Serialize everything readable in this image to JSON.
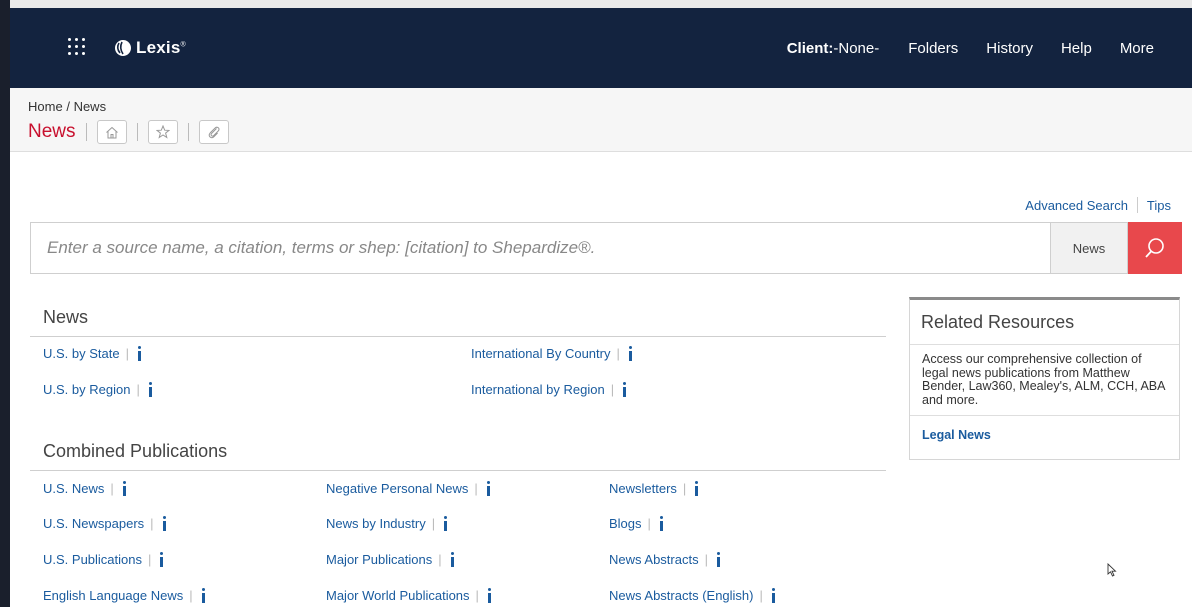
{
  "header": {
    "logo_text": "Lexis",
    "client_label": "Client:",
    "client_value": "-None-",
    "nav": [
      "Folders",
      "History",
      "Help",
      "More"
    ]
  },
  "breadcrumb": {
    "home": "Home",
    "separator": "/",
    "current": "News"
  },
  "page_title": "News",
  "search": {
    "advanced_label": "Advanced Search",
    "tips_label": "Tips",
    "placeholder": "Enter a source name, a citation, terms or shep: [citation] to Shepardize®.",
    "scope_label": "News"
  },
  "news_section": {
    "title": "News",
    "links": [
      "U.S. by State",
      "International By Country",
      "U.S. by Region",
      "International by Region"
    ]
  },
  "combined_section": {
    "title": "Combined Publications",
    "columns": [
      [
        "U.S. News",
        "U.S. Newspapers",
        "U.S. Publications",
        "English Language News"
      ],
      [
        "Negative Personal News",
        "News by Industry",
        "Major Publications",
        "Major World Publications"
      ],
      [
        "Newsletters",
        "Blogs",
        "News Abstracts",
        "News Abstracts (English)"
      ]
    ]
  },
  "related": {
    "title": "Related Resources",
    "text": "Access our comprehensive collection of legal news publications from Matthew Bender, Law360, Mealey's, ALM, CCH, ABA and more.",
    "link": "Legal News"
  },
  "colors": {
    "header_bg": "#13233f",
    "accent_red": "#c8102e",
    "search_button": "#e8484c",
    "link_blue": "#1a5b9e"
  }
}
